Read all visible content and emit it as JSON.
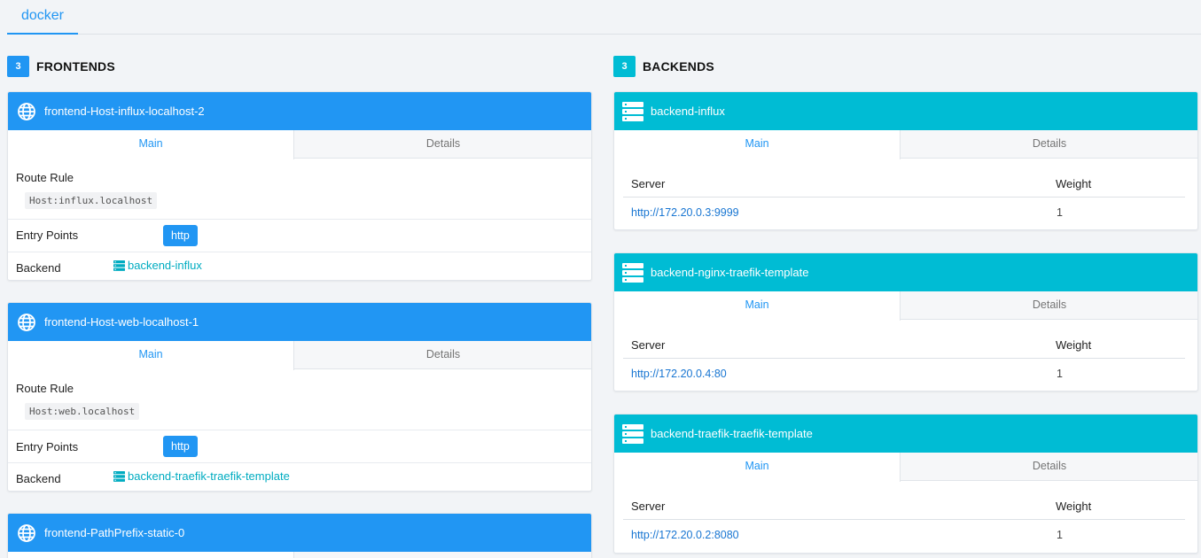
{
  "provider_tab": "docker",
  "frontends": {
    "count": "3",
    "title": "FRONTENDS",
    "items": [
      {
        "name": "frontend-Host-influx-localhost-2",
        "tabs": [
          "Main",
          "Details"
        ],
        "route_rule_label": "Route Rule",
        "route_rule": "Host:influx.localhost",
        "entry_points_label": "Entry Points",
        "entry_point": "http",
        "backend_label": "Backend",
        "backend": "backend-influx"
      },
      {
        "name": "frontend-Host-web-localhost-1",
        "tabs": [
          "Main",
          "Details"
        ],
        "route_rule_label": "Route Rule",
        "route_rule": "Host:web.localhost",
        "entry_points_label": "Entry Points",
        "entry_point": "http",
        "backend_label": "Backend",
        "backend": "backend-traefik-traefik-template"
      },
      {
        "name": "frontend-PathPrefix-static-0"
      }
    ]
  },
  "backends": {
    "count": "3",
    "title": "BACKENDS",
    "items": [
      {
        "name": "backend-influx",
        "tabs": [
          "Main",
          "Details"
        ],
        "server_header": "Server",
        "weight_header": "Weight",
        "server": "http://172.20.0.3:9999",
        "weight": "1"
      },
      {
        "name": "backend-nginx-traefik-template",
        "tabs": [
          "Main",
          "Details"
        ],
        "server_header": "Server",
        "weight_header": "Weight",
        "server": "http://172.20.0.4:80",
        "weight": "1"
      },
      {
        "name": "backend-traefik-traefik-template",
        "tabs": [
          "Main",
          "Details"
        ],
        "server_header": "Server",
        "weight_header": "Weight",
        "server": "http://172.20.0.2:8080",
        "weight": "1"
      }
    ]
  },
  "colors": {
    "frontend_accent": "#2196f3",
    "backend_accent": "#00bcd4",
    "link": "#00acc1"
  },
  "icons": {
    "frontend": "globe-icon",
    "backend": "server-icon"
  }
}
